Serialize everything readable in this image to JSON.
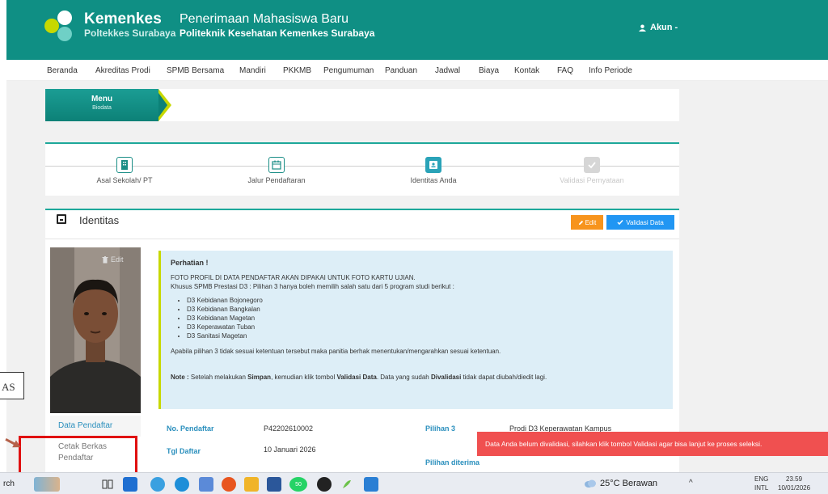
{
  "header": {
    "brand_line1": "Kemenkes",
    "brand_line2": "Poltekkes Surabaya",
    "title_line1": "Penerimaan Mahasiswa Baru",
    "title_line2": "Politeknik Kesehatan Kemenkes Surabaya",
    "account_label": "Akun -",
    "bg_color": "#0f8f84"
  },
  "nav": {
    "items": [
      "Beranda",
      "Akreditas Prodi",
      "SPMB Bersama",
      "Mandiri",
      "PKKMB",
      "Pengumuman",
      "Panduan",
      "Jadwal",
      "Biaya",
      "Kontak",
      "FAQ",
      "Info Periode"
    ]
  },
  "menu": {
    "title": "Menu",
    "subtitle": "Biodata"
  },
  "steps": [
    {
      "label": "Asal Sekolah/ PT",
      "icon": "building-icon",
      "state": "done"
    },
    {
      "label": "Jalur Pendaftaran",
      "icon": "calendar-icon",
      "state": "done"
    },
    {
      "label": "Identitas Anda",
      "icon": "id-card-icon",
      "state": "active"
    },
    {
      "label": "Validasi Pernyataan",
      "icon": "check-icon",
      "state": "disabled"
    }
  ],
  "identitas": {
    "title": "Identitas",
    "edit_label": "Edit",
    "validasi_label": "Validasi Data",
    "photo_edit_label": "Edit"
  },
  "info": {
    "heading": "Perhatian !",
    "line1": "FOTO PROFIL DI DATA PENDAFTAR AKAN DIPAKAI UNTUK FOTO KARTU UJIAN.",
    "line2": "Khusus SPMB Prestasi D3 : Pilihan 3 hanya boleh memilih salah satu dari 5 program studi berikut :",
    "programs": [
      "D3 Kebidanan Bojonegoro",
      "D3 Kebidanan Bangkalan",
      "D3 Kebidanan Magetan",
      "D3 Keperawatan Tuban",
      "D3 Sanitasi Magetan"
    ],
    "line3": "Apabila pilihan 3 tidak sesuai ketentuan tersebut maka panitia berhak menentukan/mengarahkan sesuai ketentuan.",
    "note_label": "Note :",
    "note_part1": " Setelah melakukan ",
    "note_simpan": "Simpan",
    "note_part2": ", kemudian klik tombol ",
    "note_validasi": "Validasi Data",
    "note_part3": ". Data yang sudah ",
    "note_divalidasi": "Divalidasi",
    "note_part4": " tidak dapat diubah/diedit lagi."
  },
  "sidebar": {
    "item1": "Data Pendaftar",
    "item2_line1": "Cetak Berkas",
    "item2_line2": "Pendaftar"
  },
  "annotation": {
    "side_text": "AS"
  },
  "table": {
    "no_pendaftar_label": "No. Pendaftar",
    "no_pendaftar_value": "P42202610002",
    "tgl_daftar_label": "Tgl Daftar",
    "tgl_daftar_value": "10 Januari 2026",
    "pilihan3_label": "Pilihan 3",
    "pilihan3_value": "Prodi D3 Keperawatan Kampus",
    "pilihan_diterima_label": "Pilihan diterima"
  },
  "toast": {
    "message": "Data Anda belum divalidasi, silahkan klik tombol Validasi agar bisa lanjut ke proses seleksi."
  },
  "taskbar": {
    "search_fragment": "rch",
    "weather": "25°C Berawan",
    "lang_line1": "ENG",
    "lang_line2": "INTL",
    "time": "23.59",
    "date": "10/01/2026",
    "notification_badge": "50"
  }
}
